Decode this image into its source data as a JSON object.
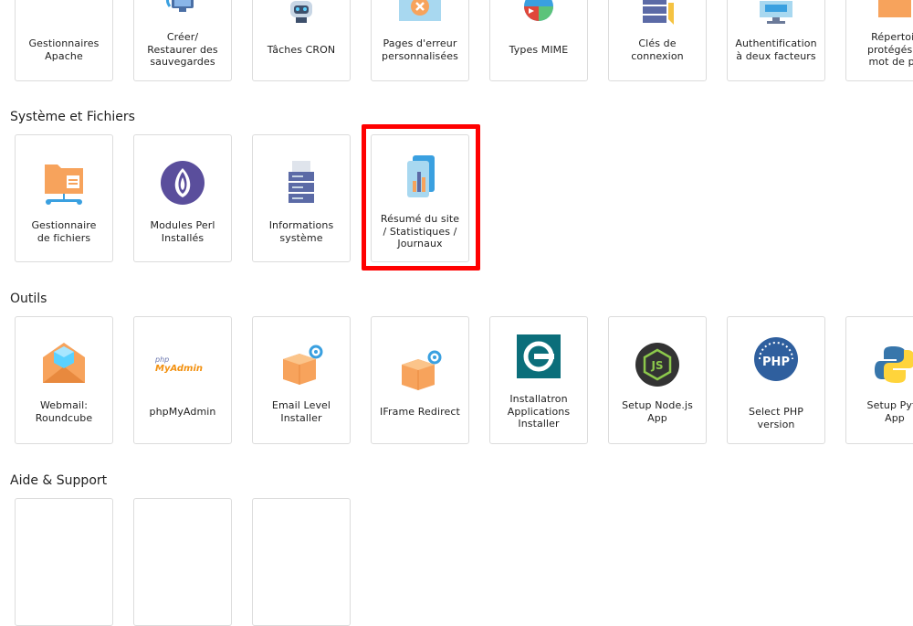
{
  "sections": {
    "systeme": "Système et Fichiers",
    "outils": "Outils",
    "aide": "Aide & Support"
  },
  "top_row": [
    {
      "label": "Gestionnaires\nApache",
      "icon": "apache-feather-icon"
    },
    {
      "label": "Créer/\nRestaurer des\nsauvegardes",
      "icon": "backup-restore-icon"
    },
    {
      "label": "Tâches CRON",
      "icon": "robot-icon"
    },
    {
      "label": "Pages d'erreur\npersonnalisées",
      "icon": "error-page-icon"
    },
    {
      "label": "Types MIME",
      "icon": "mime-types-icon"
    },
    {
      "label": "Clés de\nconnexion",
      "icon": "server-key-icon"
    },
    {
      "label": "Authentification\nà deux facteurs",
      "icon": "monitor-icon"
    },
    {
      "label": "Répertoir\nprotégés p\nmot de pa",
      "icon": "folder-lock-icon"
    }
  ],
  "systeme_row": [
    {
      "label": "Gestionnaire\nde fichiers",
      "icon": "file-manager-icon"
    },
    {
      "label": "Modules Perl\nInstallés",
      "icon": "perl-onion-icon"
    },
    {
      "label": "Informations\nsystème",
      "icon": "server-info-icon"
    },
    {
      "label": "Résumé du site\n/ Statistiques /\nJournaux",
      "icon": "stats-chart-icon"
    }
  ],
  "outils_row": [
    {
      "label": "Webmail:\nRoundcube",
      "icon": "roundcube-envelope-icon"
    },
    {
      "label": "phpMyAdmin",
      "icon": "phpmyadmin-logo-icon"
    },
    {
      "label": "Email Level\nInstaller",
      "icon": "package-gear-icon"
    },
    {
      "label": "IFrame Redirect",
      "icon": "package-gear-icon"
    },
    {
      "label": "Installatron\nApplications\nInstaller",
      "icon": "installatron-icon"
    },
    {
      "label": "Setup Node.js\nApp",
      "icon": "nodejs-icon"
    },
    {
      "label": "Select PHP\nversion",
      "icon": "php-icon"
    },
    {
      "label": "Setup Pyth\nApp",
      "icon": "python-icon"
    }
  ],
  "phpmyadmin_logo": {
    "top": "php",
    "bottom": "MyAdmin"
  },
  "php_badge": "PHP",
  "node_badge": "JS",
  "colors": {
    "highlight": "#ff0000",
    "border": "#dcdcdc",
    "orange": "#f7a35c",
    "blue": "#3aa0e0"
  }
}
